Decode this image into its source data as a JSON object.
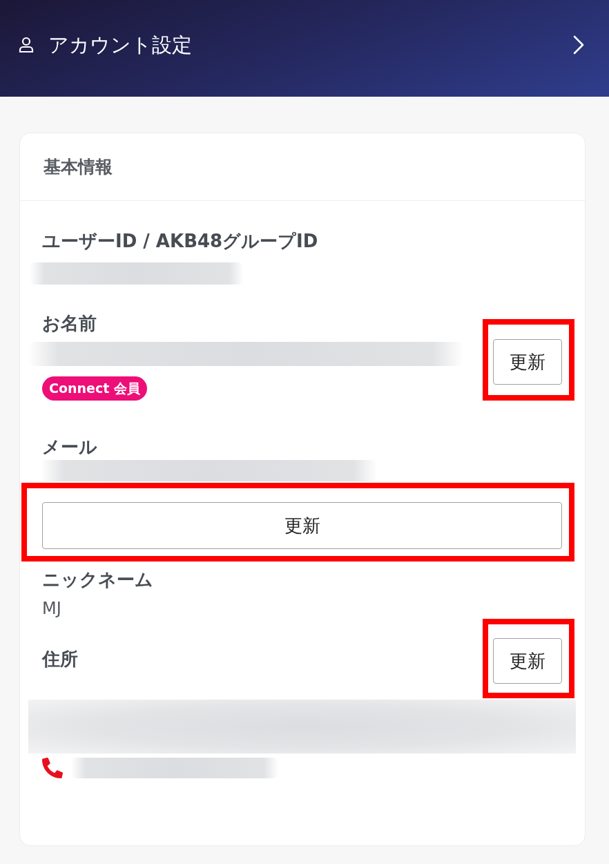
{
  "header": {
    "title": "アカウント設定"
  },
  "card": {
    "title": "基本情報",
    "fields": [
      {
        "label": "ユーザーID / AKB48グループID",
        "kind": "blurred"
      },
      {
        "label": "お名前",
        "kind": "blurred",
        "badge": "Connect 会員",
        "button": {
          "label": "更新",
          "kind": "side",
          "highlighted": true
        }
      },
      {
        "label": "メール",
        "kind": "blurred",
        "button": {
          "label": "更新",
          "kind": "wide",
          "highlighted": true
        }
      },
      {
        "label": "ニックネーム",
        "kind": "text",
        "value": "MJ"
      },
      {
        "label": "住所",
        "kind": "address",
        "button": {
          "label": "更新",
          "kind": "side",
          "highlighted": true
        }
      }
    ]
  }
}
